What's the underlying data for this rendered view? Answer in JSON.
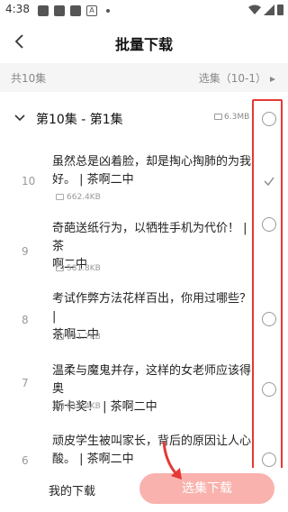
{
  "status_bar": {
    "time": "4:38"
  },
  "header": {
    "title": "批量下载"
  },
  "summary": {
    "count": "共10集",
    "select": "选集（10-1）"
  },
  "season": {
    "label": "第10集 - 第1集",
    "size": "6.3MB"
  },
  "episodes": [
    {
      "num": "10",
      "line1": "虽然总是凶着脸，却是掏心掏肺的为我",
      "line2": "好。 | 茶啊二中",
      "size": "662.4KB",
      "selected": true
    },
    {
      "num": "9",
      "line1": "奇葩送纸行为，以牺牲手机为代价！ | 茶",
      "line2": "啊二中",
      "size": "581.8KB",
      "selected": false
    },
    {
      "num": "8",
      "line1": "考试作弊方法花样百出，你用过哪些？ |",
      "line2": "茶啊二中",
      "size": "641.7KB",
      "selected": false
    },
    {
      "num": "7",
      "line1": "温柔与魔鬼并存，这样的女老师应该得奥",
      "line2": "斯卡奖！ | 茶啊二中",
      "size": "612.4KB",
      "selected": false
    },
    {
      "num": "6",
      "line1": "顽皮学生被叫家长，背后的原因让人心",
      "line2": "酸。 | 茶啊二中",
      "size": "",
      "selected": false
    }
  ],
  "bottom": {
    "my_downloads": "我的下载",
    "download_button": "选集下载"
  },
  "colors": {
    "accent": "#f9b2ad",
    "highlight": "#e53935",
    "arrow": "#e53935"
  }
}
